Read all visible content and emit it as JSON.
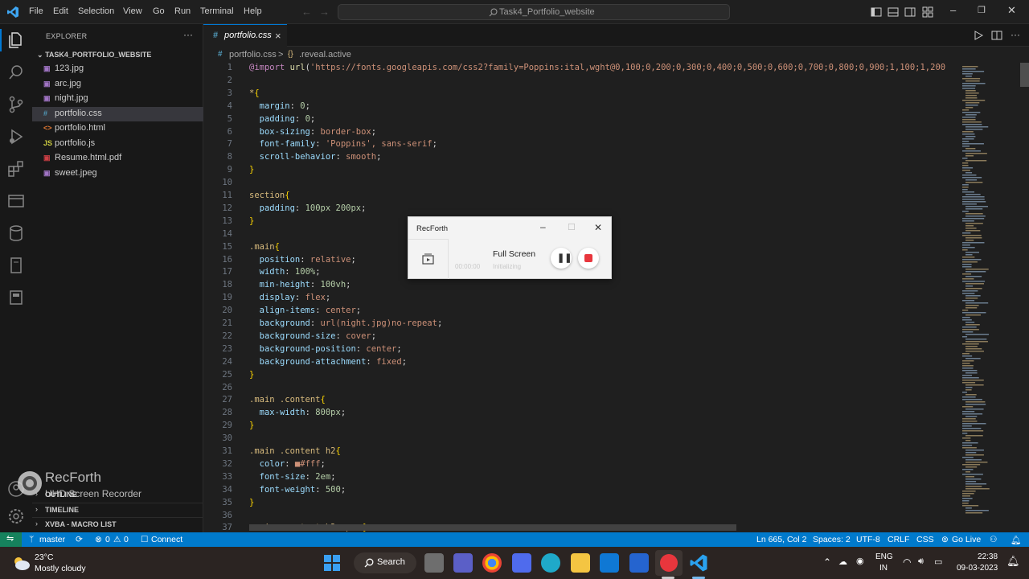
{
  "titlebar": {
    "menus": [
      "File",
      "Edit",
      "Selection",
      "View",
      "Go",
      "Run",
      "Terminal",
      "Help"
    ],
    "search_text": "Task4_Portfolio_website"
  },
  "explorer": {
    "title": "EXPLORER",
    "more": "···",
    "folder": "TASK4_PORTFOLIO_WEBSITE",
    "files": [
      {
        "name": "123.jpg",
        "icon": "image-icon"
      },
      {
        "name": "arc.jpg",
        "icon": "image-icon"
      },
      {
        "name": "night.jpg",
        "icon": "image-icon"
      },
      {
        "name": "portfolio.css",
        "icon": "css-icon",
        "glyph": "#"
      },
      {
        "name": "portfolio.html",
        "icon": "html-icon",
        "glyph": "<>"
      },
      {
        "name": "portfolio.js",
        "icon": "js-icon",
        "glyph": "JS"
      },
      {
        "name": "Resume.html.pdf",
        "icon": "pdf-icon"
      },
      {
        "name": "sweet.jpeg",
        "icon": "image-icon"
      }
    ],
    "sections": [
      "OUTLINE",
      "TIMELINE",
      "XVBA - MACRO LIST"
    ]
  },
  "watermark": {
    "title": "RecForth",
    "subtitle": "UHD Screen Recorder"
  },
  "tab": {
    "label": "portfolio.css",
    "glyph": "#",
    "close": "×"
  },
  "breadcrumb": {
    "file": "portfolio.css",
    "sep": ">",
    "symbol": ".reveal.active"
  },
  "code_lines": [
    {
      "n": "1",
      "t": "@import url('https://fonts.googleapis.com/css2?family=Poppins:ital,wght@0,100;0,200;0,300;0,400;0,500;0,600;0,700;0,800;0,900;1,100;1,200"
    },
    {
      "n": "2",
      "t": ""
    },
    {
      "n": "3",
      "t": "*{"
    },
    {
      "n": "4",
      "t": "  margin: 0;"
    },
    {
      "n": "5",
      "t": "  padding: 0;"
    },
    {
      "n": "6",
      "t": "  box-sizing: border-box;"
    },
    {
      "n": "7",
      "t": "  font-family: 'Poppins', sans-serif;"
    },
    {
      "n": "8",
      "t": "  scroll-behavior: smooth;"
    },
    {
      "n": "9",
      "t": "}"
    },
    {
      "n": "10",
      "t": ""
    },
    {
      "n": "11",
      "t": "section{"
    },
    {
      "n": "12",
      "t": "  padding: 100px 200px;"
    },
    {
      "n": "13",
      "t": "}"
    },
    {
      "n": "14",
      "t": ""
    },
    {
      "n": "15",
      "t": ".main{"
    },
    {
      "n": "16",
      "t": "  position: relative;"
    },
    {
      "n": "17",
      "t": "  width: 100%;"
    },
    {
      "n": "18",
      "t": "  min-height: 100vh;"
    },
    {
      "n": "19",
      "t": "  display: flex;"
    },
    {
      "n": "20",
      "t": "  align-items: center;"
    },
    {
      "n": "21",
      "t": "  background: url(night.jpg)no-repeat;"
    },
    {
      "n": "22",
      "t": "  background-size: cover;"
    },
    {
      "n": "23",
      "t": "  background-position: center;"
    },
    {
      "n": "24",
      "t": "  background-attachment: fixed;"
    },
    {
      "n": "25",
      "t": "}"
    },
    {
      "n": "26",
      "t": ""
    },
    {
      "n": "27",
      "t": ".main .content{"
    },
    {
      "n": "28",
      "t": "  max-width: 800px;"
    },
    {
      "n": "29",
      "t": "}"
    },
    {
      "n": "30",
      "t": ""
    },
    {
      "n": "31",
      "t": ".main .content h2{"
    },
    {
      "n": "32",
      "t": "  color: ■#fff;"
    },
    {
      "n": "33",
      "t": "  font-size: 2em;"
    },
    {
      "n": "34",
      "t": "  font-weight: 500;"
    },
    {
      "n": "35",
      "t": "}"
    },
    {
      "n": "36",
      "t": ""
    },
    {
      "n": "37",
      "t": ".main .content h2 span{"
    }
  ],
  "recforth": {
    "title": "RecForth",
    "mode": "Full Screen",
    "timer": "00:00:00",
    "status": "Initializing"
  },
  "statusbar": {
    "branch": "master",
    "errors": "0",
    "warnings": "0",
    "connect": "Connect",
    "position": "Ln 665, Col 2",
    "spaces": "Spaces: 2",
    "encoding": "UTF-8",
    "eol": "CRLF",
    "language": "CSS",
    "golive": "Go Live"
  },
  "taskbar": {
    "temp": "23°C",
    "weather": "Mostly cloudy",
    "search": "Search",
    "lang1": "ENG",
    "lang2": "IN",
    "time": "22:38",
    "date": "09-03-2023"
  },
  "colors": {
    "accent": "#007acc",
    "activity": "#181818",
    "editor": "#1f1f1f",
    "record": "#e8363d"
  }
}
